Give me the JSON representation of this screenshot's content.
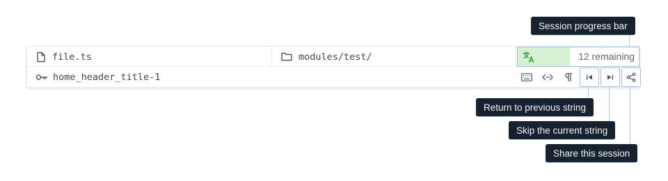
{
  "file": {
    "icon": "file-icon",
    "name": "file.ts"
  },
  "folder": {
    "icon": "folder-icon",
    "path": "modules/test/"
  },
  "progress": {
    "icon": "translate-icon",
    "remaining_label": "12 remaining",
    "fraction_complete": 0.43,
    "fill_color": "#d6f1d1",
    "border_color": "#9cc3e6"
  },
  "string_key": {
    "icon": "key-icon",
    "name": "home_header_title-1"
  },
  "toolbar": {
    "buttons": [
      {
        "name": "keyboard-button",
        "icon": "keyboard-icon"
      },
      {
        "name": "code-button",
        "icon": "code-icon"
      },
      {
        "name": "pilcrow-button",
        "icon": "pilcrow-icon"
      },
      {
        "name": "previous-string-button",
        "icon": "skip-back-icon",
        "highlighted": true
      },
      {
        "name": "skip-string-button",
        "icon": "skip-forward-icon",
        "highlighted": true
      },
      {
        "name": "share-session-button",
        "icon": "share-icon",
        "highlighted": true
      }
    ]
  },
  "tooltips": {
    "progress": "Session progress bar",
    "previous": "Return to previous string",
    "skip": "Skip the current string",
    "share": "Share this session"
  },
  "colors": {
    "tooltip_bg": "#16232e",
    "guide_line": "#a8c9e6",
    "text": "#3a4652"
  }
}
